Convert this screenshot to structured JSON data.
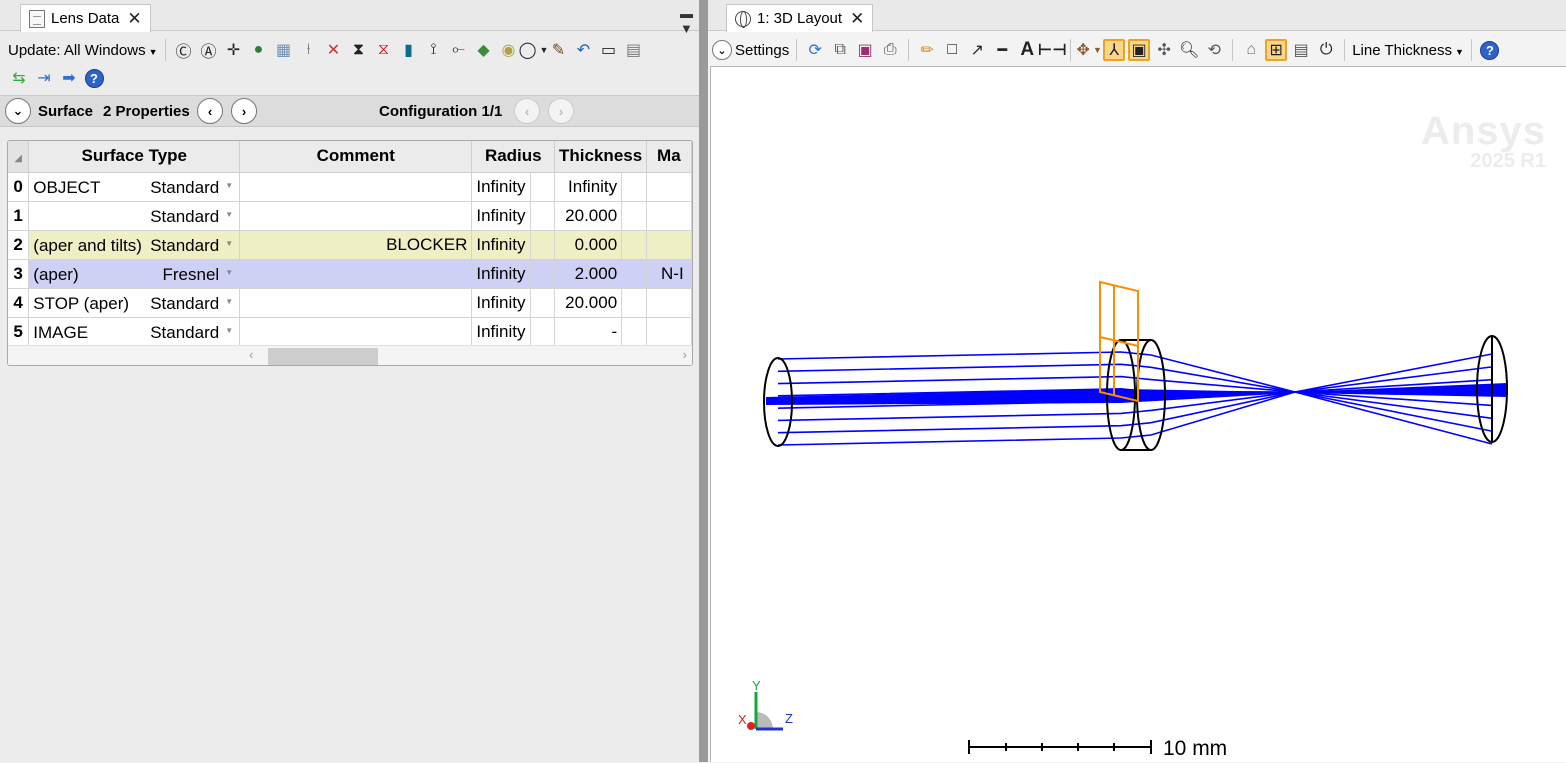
{
  "left_window": {
    "tab_label": "Lens Data",
    "toolbar": {
      "update_label": "Update: All Windows"
    },
    "surface_bar": {
      "surface_label": "Surface",
      "properties_label": "2 Properties",
      "configuration_label": "Configuration 1/1"
    },
    "table": {
      "columns": [
        "Surface Type",
        "Comment",
        "Radius",
        "Thickness",
        "Ma"
      ],
      "rows": [
        {
          "num": "0",
          "name": "OBJECT",
          "type": "Standard",
          "comment": "",
          "radius": "Infinity",
          "thickness": "Infinity",
          "material": ""
        },
        {
          "num": "1",
          "name": "",
          "type": "Standard",
          "comment": "",
          "radius": "Infinity",
          "thickness": "20.000",
          "material": ""
        },
        {
          "num": "2",
          "name": "(aper and tilts)",
          "type": "Standard",
          "comment": "BLOCKER",
          "radius": "Infinity",
          "thickness": "0.000",
          "material": ""
        },
        {
          "num": "3",
          "name": "(aper)",
          "type": "Fresnel",
          "comment": "",
          "radius": "Infinity",
          "thickness": "2.000",
          "material": "N-I"
        },
        {
          "num": "4",
          "name": "STOP (aper)",
          "type": "Standard",
          "comment": "",
          "radius": "Infinity",
          "thickness": "20.000",
          "material": ""
        },
        {
          "num": "5",
          "name": "IMAGE",
          "type": "Standard",
          "comment": "",
          "radius": "Infinity",
          "thickness": "-",
          "material": ""
        }
      ]
    }
  },
  "right_window": {
    "tab_label": "1: 3D Layout",
    "toolbar": {
      "settings_label": "Settings",
      "line_thickness_label": "Line Thickness"
    },
    "watermark": {
      "brand": "Ansys",
      "version": "2025 R1"
    },
    "axes": {
      "y": "Y",
      "x": "X",
      "z": "Z"
    },
    "scale_bar_label": "10 mm"
  },
  "colors": {
    "rays": "#0000ff",
    "blocker": "#ff8c00",
    "lens_outline": "#000000",
    "row_selected": "#cfd0f5",
    "row_highlight": "#efefc5",
    "toggle_active": "#fbd68a"
  },
  "icons": [
    "gear-icon",
    "refresh-icon",
    "copy-icon",
    "save-icon",
    "print-icon",
    "pencil-icon",
    "rectangle-icon",
    "arrow-line-icon",
    "line-icon",
    "text-icon",
    "dimension-icon",
    "rotate-icon",
    "axes-icon",
    "fit-icon",
    "zoom-icon",
    "help-icon"
  ]
}
